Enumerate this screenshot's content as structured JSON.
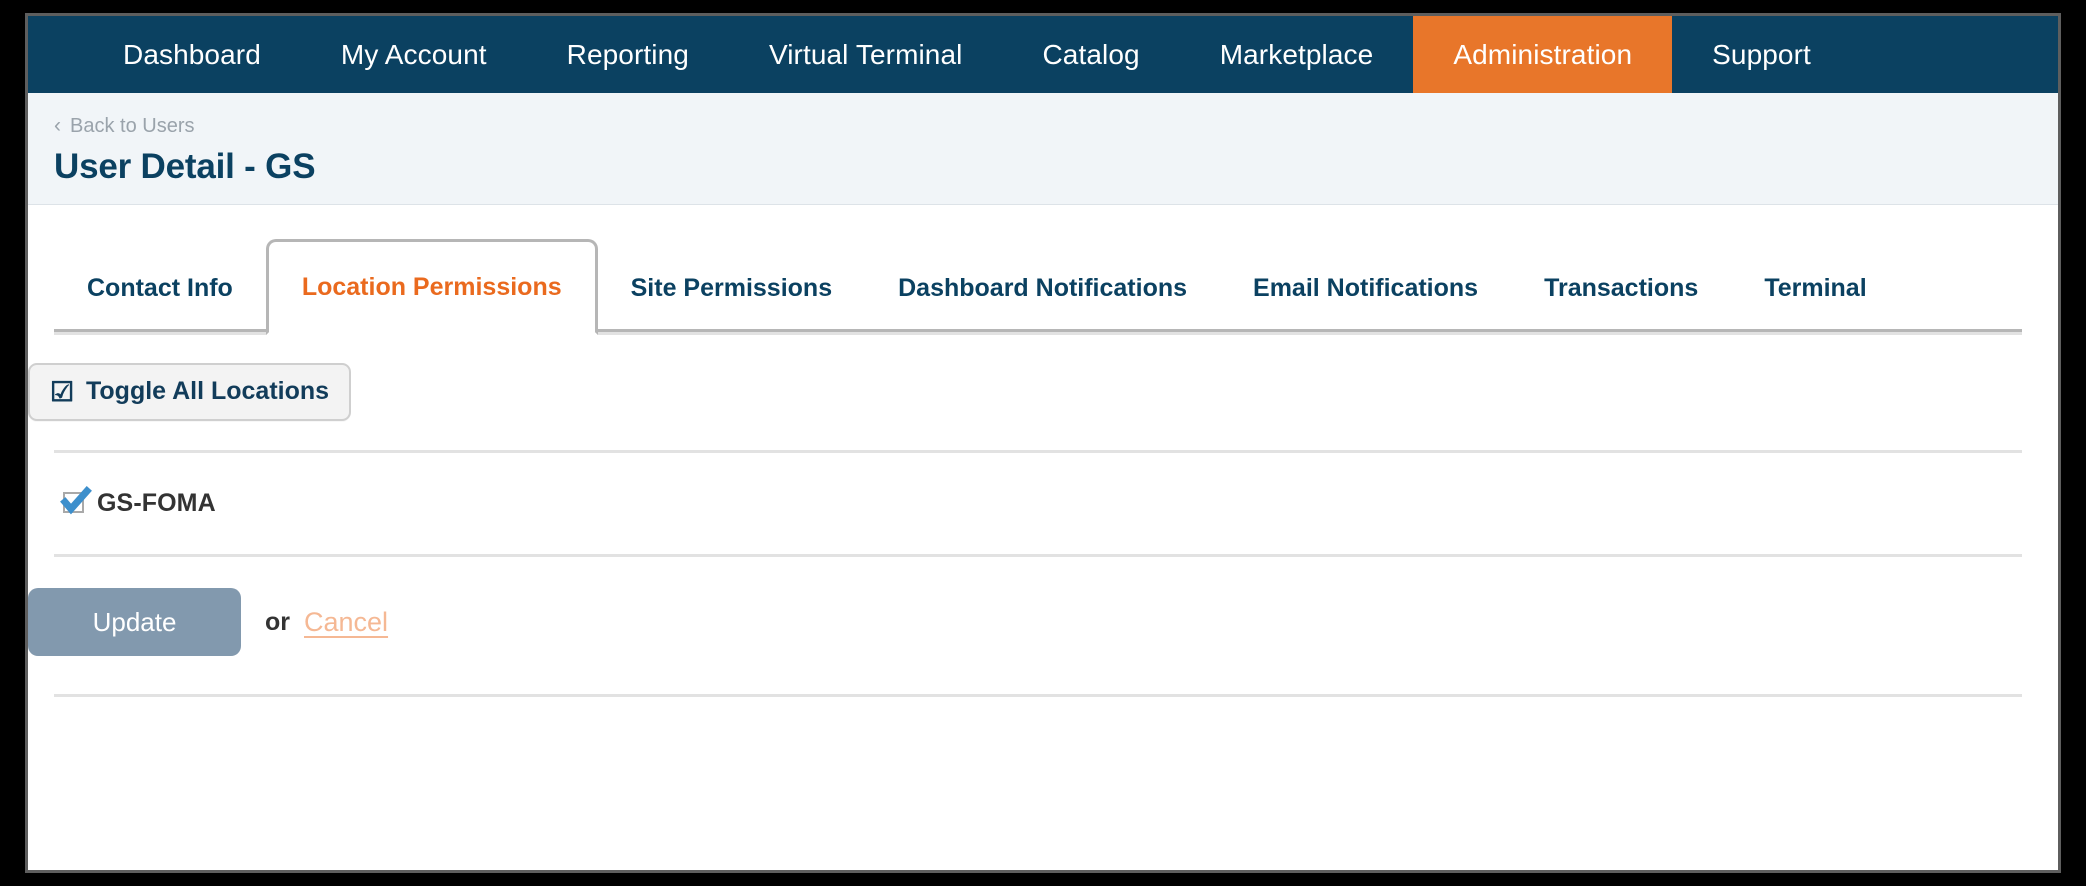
{
  "topnav": {
    "items": [
      {
        "label": "Dashboard",
        "active": false
      },
      {
        "label": "My Account",
        "active": false
      },
      {
        "label": "Reporting",
        "active": false
      },
      {
        "label": "Virtual Terminal",
        "active": false
      },
      {
        "label": "Catalog",
        "active": false
      },
      {
        "label": "Marketplace",
        "active": false
      },
      {
        "label": "Administration",
        "active": true
      },
      {
        "label": "Support",
        "active": false
      }
    ],
    "background_color": "#0b4161",
    "active_color": "#e8762a"
  },
  "header": {
    "breadcrumb_label": "Back to Users",
    "breadcrumb_icon": "chevron-left-icon",
    "page_title": "User Detail - GS",
    "background_color": "#f1f5f8",
    "title_color": "#0b4161"
  },
  "tabs": [
    {
      "label": "Contact Info",
      "active": false
    },
    {
      "label": "Location Permissions",
      "active": true
    },
    {
      "label": "Site Permissions",
      "active": false
    },
    {
      "label": "Dashboard Notifications",
      "active": false
    },
    {
      "label": "Email Notifications",
      "active": false
    },
    {
      "label": "Transactions",
      "active": false
    },
    {
      "label": "Terminal",
      "active": false
    }
  ],
  "tab_active_color": "#ea6a1e",
  "tab_inactive_color": "#0b4161",
  "main": {
    "toggle_all": {
      "label": "Toggle All Locations",
      "icon": "checkbox-checked-icon"
    },
    "locations": [
      {
        "name": "GS-FOMA",
        "checked": true
      }
    ],
    "actions": {
      "update_label": "Update",
      "update_color": "#8299ae",
      "or_label": "or",
      "cancel_label": "Cancel",
      "cancel_color": "#f5b894"
    }
  }
}
